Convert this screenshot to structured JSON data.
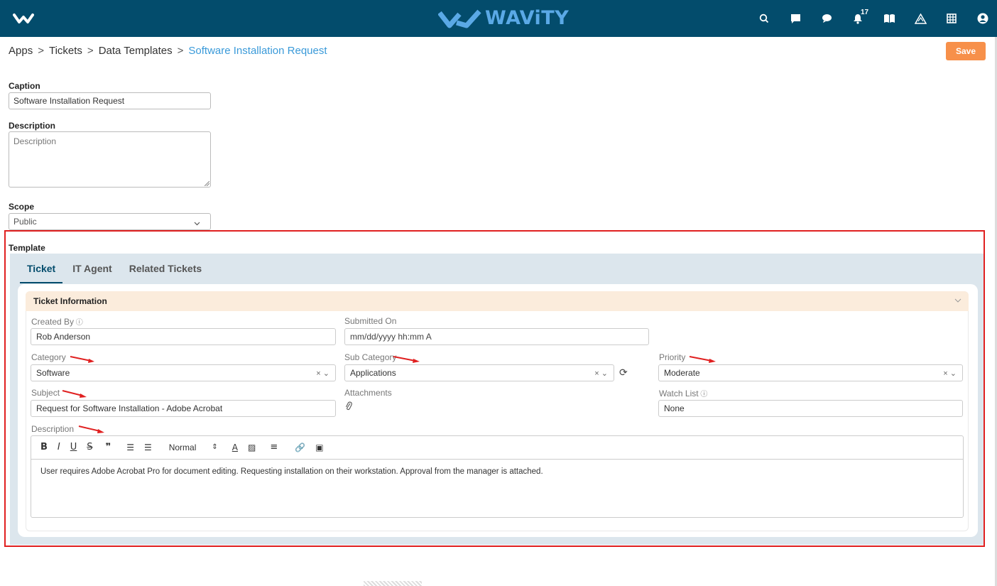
{
  "header": {
    "brand": "WAViTY",
    "notification_count": "17",
    "icons": [
      "search-icon",
      "chat-icon",
      "comment-icon",
      "bell-icon",
      "book-icon",
      "triangle-icon",
      "grid-icon",
      "user-icon"
    ]
  },
  "breadcrumb": {
    "items": [
      "Apps",
      "Tickets",
      "Data Templates"
    ],
    "current": "Software Installation Request",
    "separator": ">"
  },
  "toolbar": {
    "save_label": "Save"
  },
  "form": {
    "caption_label": "Caption",
    "caption_value": "Software Installation Request",
    "description_label": "Description",
    "description_placeholder": "Description",
    "scope_label": "Scope",
    "scope_value": "Public"
  },
  "template": {
    "label": "Template",
    "tabs": [
      {
        "label": "Ticket",
        "active": true
      },
      {
        "label": "IT Agent",
        "active": false
      },
      {
        "label": "Related Tickets",
        "active": false
      }
    ],
    "section_title": "Ticket Information",
    "fields": {
      "created_by_label": "Created By",
      "created_by_value": "Rob Anderson",
      "submitted_on_label": "Submitted On",
      "submitted_on_placeholder": "mm/dd/yyyy hh:mm A",
      "category_label": "Category",
      "category_value": "Software",
      "sub_category_label": "Sub Category",
      "sub_category_value": "Applications",
      "priority_label": "Priority",
      "priority_value": "Moderate",
      "subject_label": "Subject",
      "subject_value": "Request for Software Installation - Adobe Acrobat",
      "attachments_label": "Attachments",
      "watch_list_label": "Watch List",
      "watch_list_value": "None",
      "description_label": "Description",
      "description_text": "User requires Adobe Acrobat Pro for document editing. Requesting installation on their workstation. Approval from the manager is attached.",
      "editor_format": "Normal"
    }
  },
  "colors": {
    "header_bg": "#034c6c",
    "save_button": "#f7904a",
    "section_header": "#fbecdc",
    "highlight_box": "#e02020"
  }
}
